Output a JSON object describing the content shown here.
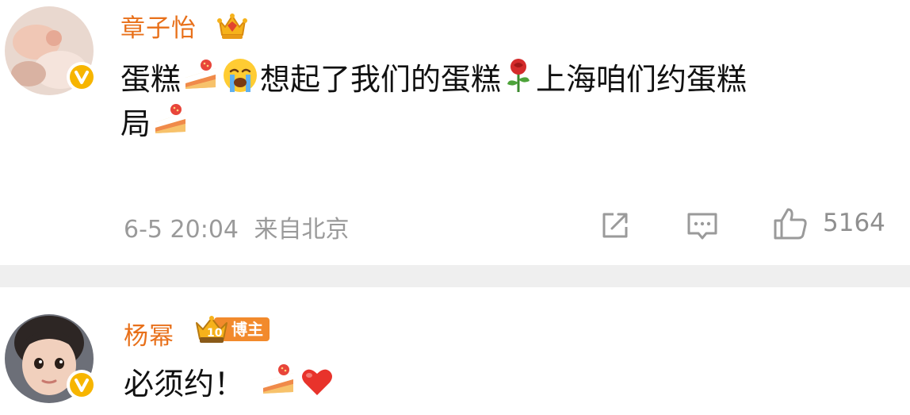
{
  "comments": [
    {
      "username": "章子怡",
      "content_line1": [
        "蛋糕",
        "想起了我们的蛋糕",
        "上海咱们约蛋糕"
      ],
      "content_line2": [
        "局"
      ],
      "emojis": [
        "cake-emoji",
        "crying-face-emoji",
        "rose-emoji",
        "cake-emoji"
      ],
      "timestamp": "6-5 20:04",
      "location": "来自北京",
      "like_count": "5164",
      "crown_icon": "gold-crown-icon",
      "verified_icon": "yellow-v-badge"
    },
    {
      "username": "杨幂",
      "badge_label": "博主",
      "badge_level": "10",
      "content": "必须约！",
      "emojis": [
        "cake-emoji",
        "red-heart-emoji"
      ],
      "verified_icon": "yellow-v-badge"
    }
  ],
  "colors": {
    "username": "#e8701a",
    "meta_text": "#9a9a9a",
    "divider": "#efefef",
    "badge_orange": "#f28a2c",
    "verified_yellow": "#f7b500"
  }
}
